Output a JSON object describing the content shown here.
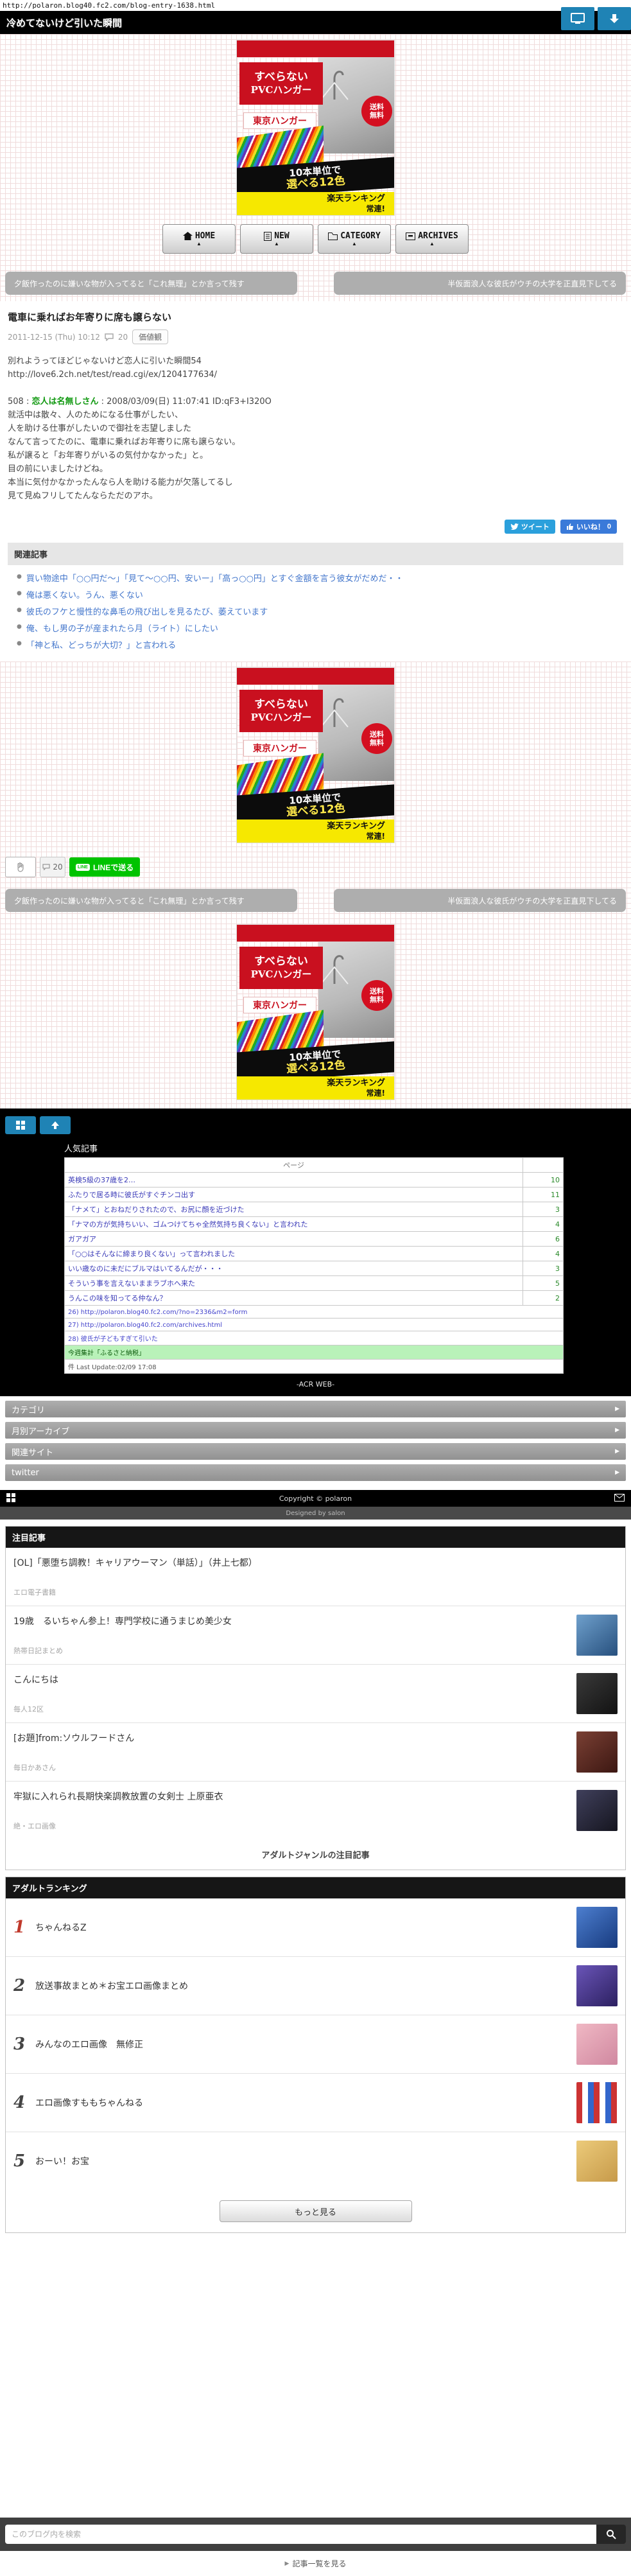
{
  "page": {
    "url": "http://polaron.blog40.fc2.com/blog-entry-1638.html",
    "site_title": "冷めてないけど引いた瞬間"
  },
  "ad": {
    "catch1": "すべらない",
    "catch2": "PVCハンガー",
    "brand": "東京ハンガー",
    "shipping1": "送料",
    "shipping2": "無料",
    "units1": "10本単位で",
    "units2": "選べる12色",
    "rakuten1": "楽天ランキング",
    "rakuten2": "常連!"
  },
  "nav": {
    "home": "HOME",
    "new": "NEW",
    "category": "CATEGORY",
    "archives": "ARCHIVES"
  },
  "pager": {
    "prev": "夕飯作ったのに嫌いな物が入ってると「これ無理」とか言って残す",
    "next": "半仮面浪人な彼氏がウチの大学を正直見下してる"
  },
  "entry": {
    "title": "電車に乗ればお年寄りに席も譲らない",
    "date": "2011-12-15 (Thu) 10:12",
    "comment_count": "20",
    "category": "価値観",
    "source_title": "別れようってほどじゃないけど恋人に引いた瞬間54",
    "source_url": "http://love6.2ch.net/test/read.cgi/ex/1204177634/",
    "res_num": "508 :",
    "res_name": "恋人は名無しさん",
    "res_info": ": 2008/03/09(日) 11:07:41 ID:qF3+I320O",
    "lines": [
      "就活中は散々、人のためになる仕事がしたい、",
      "人を助ける仕事がしたいので御社を志望しました",
      "なんて言ってたのに、電車に乗ればお年寄りに席も譲らない。",
      "私が譲ると「お年寄りがいるの気付かなかった」と。",
      "目の前にいましたけどね。",
      "本当に気付かなかったんなら人を助ける能力が欠落してるし",
      "見て見ぬフリしてたんならただのアホ。"
    ]
  },
  "share": {
    "tweet": "ツイート",
    "like": "いいね！",
    "like_count": "0"
  },
  "related": {
    "heading": "関連記事",
    "items": [
      "買い物途中「○○円だ～」「見て～○○円、安いー」「高っ○○円」とすぐ金額を言う彼女がだめだ・・",
      "俺は悪くない。うん、悪くない",
      "彼氏のフケと慢性的な鼻毛の飛び出しを見るたび、萎えています",
      "俺、もし男の子が産まれたら月（ライト）にしたい",
      "「神と私、どっちが大切？」と言われる"
    ]
  },
  "engagement": {
    "clap_count": "20",
    "line_label": "LINEで送る"
  },
  "popular": {
    "heading": "人気記事",
    "col_header": "ページ",
    "rows": [
      {
        "title": "英検5級の37歳を2…",
        "count": "10"
      },
      {
        "title": "ふたりで居る時に彼氏がすぐチンコ出す",
        "count": "11"
      },
      {
        "title": "「ナメて」とおねだりされたので、お尻に顔を近づけた",
        "count": "3"
      },
      {
        "title": "「ナマの方が気持ちいい、ゴムつけてちゃ全然気持ち良くない」と言われた",
        "count": "4"
      },
      {
        "title": "ガアガア",
        "count": "6"
      },
      {
        "title": "「○○はそんなに締まり良くない」って言われました",
        "count": "4"
      },
      {
        "title": "いい歳なのに未だにブルマはいてるんだが・・・",
        "count": "3"
      },
      {
        "title": "そういう事を言えないままラブホへ来た",
        "count": "5"
      },
      {
        "title": "うんこの味を知ってる仲なん？",
        "count": "2"
      }
    ],
    "footer_links": [
      "26) http://polaron.blog40.fc2.com/?no=2336&m2=form",
      "27) http://polaron.blog40.fc2.com/archives.html",
      "28) 彼氏が子どもすぎて引いた"
    ],
    "promo": "今週集計「ふるさと納税」",
    "last_update": "件 Last Update:02/09 17:08",
    "credit": "-ACR WEB-"
  },
  "accordion": {
    "items": [
      "カテゴリ",
      "月別アーカイブ",
      "関連サイト",
      "twitter"
    ]
  },
  "footer": {
    "copyright": "Copyright © polaron",
    "designed": "Designed by salon"
  },
  "featured": {
    "heading": "注目記事",
    "items": [
      {
        "title": "[OL]「悪堕ち調教！キャリアウーマン（単話）」（井上七都）",
        "source": "エロ電子書籍"
      },
      {
        "title": "19歳　るいちゃん参上！専門学校に通うまじめ美少女",
        "source": "熱帯日記まとめ"
      },
      {
        "title": "こんにちは",
        "source": "毎人12区"
      },
      {
        "title": "[お題]from:ソウルフードさん",
        "source": "毎日かあさん"
      },
      {
        "title": "牢獄に入れられ長期快楽調教放置の女剣士 上原亜衣",
        "source": "絶・エロ画像"
      }
    ],
    "more_link": "アダルトジャンルの注目記事"
  },
  "adult_ranking": {
    "heading": "アダルトランキング",
    "items": [
      {
        "rank": "1",
        "title": "ちゃんねるZ"
      },
      {
        "rank": "2",
        "title": "放送事故まとめ＊お宝エロ画像まとめ"
      },
      {
        "rank": "3",
        "title": "みんなのエロ画像　無修正"
      },
      {
        "rank": "4",
        "title": "エロ画像すももちゃんねる"
      },
      {
        "rank": "5",
        "title": "おーい！お宝"
      }
    ],
    "more_button": "もっと見る"
  },
  "search": {
    "placeholder": "このブログ内を検索"
  },
  "bottom": {
    "list_link": "記事一覧を見る"
  }
}
